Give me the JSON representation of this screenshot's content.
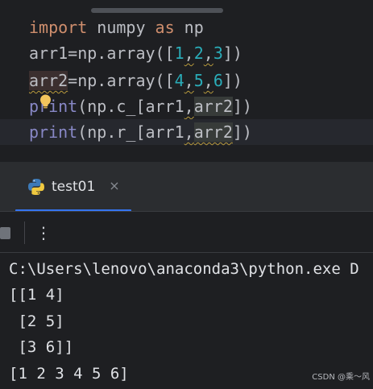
{
  "editor": {
    "lines": [
      {
        "kw1": "import",
        "mid": " numpy ",
        "kw2": "as",
        "end": " np"
      },
      {
        "pre": "arr1=np.array([",
        "n1": "1",
        "c1": ",",
        "n2": "2",
        "c2": ",",
        "n3": "3",
        "post": "])"
      },
      {
        "pre": "arr2",
        "mid": "=np.array([",
        "n1": "4",
        "c1": ",",
        "n2": "5",
        "c2": ",",
        "n3": "6",
        "post": "])"
      },
      {
        "fn": "print",
        "a": "(np.c_[arr1",
        "c": ",",
        "b": "arr2",
        "post": "])"
      },
      {
        "fn": "print",
        "a": "(np.r_[arr1",
        "c": ",",
        "b": "arr2",
        "post": "])"
      }
    ],
    "bulb_icon": "lightbulb-icon"
  },
  "run_panel": {
    "tab_label": "test01",
    "tab_icon": "python-icon",
    "close_glyph": "×",
    "kebab_glyph": "⋮"
  },
  "console": {
    "lines": [
      "C:\\Users\\lenovo\\anaconda3\\python.exe D",
      "[[1 4]",
      " [2 5]",
      " [3 6]]",
      "[1 2 3 4 5 6]"
    ]
  },
  "watermark": "CSDN @乘～风",
  "colors": {
    "background": "#1e1f22",
    "panel": "#2b2d30",
    "keyword": "#cf8e6d",
    "builtin": "#8888c6",
    "number": "#2aacb8",
    "tab_accent": "#3574f0"
  }
}
